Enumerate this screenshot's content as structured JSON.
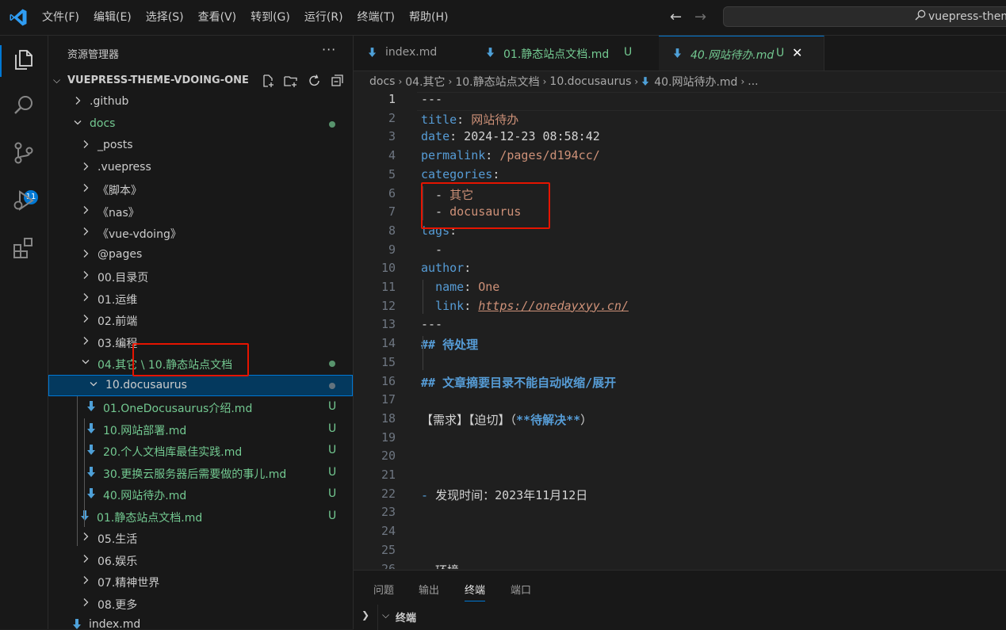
{
  "menu": [
    "文件(F)",
    "编辑(E)",
    "选择(S)",
    "查看(V)",
    "转到(G)",
    "运行(R)",
    "终端(T)",
    "帮助(H)"
  ],
  "search": {
    "text": "vuepress-them"
  },
  "activity": {
    "source_control_badge": "11"
  },
  "explorer": {
    "title": "资源管理器",
    "more": "···",
    "project": "VUEPRESS-THEME-VDOING-ONE",
    "tree": [
      {
        "label": ".github",
        "kind": "folder",
        "open": false,
        "indent": 0
      },
      {
        "label": "docs",
        "kind": "folder",
        "open": true,
        "indent": 0,
        "status": "dot",
        "color": "green"
      },
      {
        "label": "_posts",
        "kind": "folder",
        "open": false,
        "indent": 1
      },
      {
        "label": ".vuepress",
        "kind": "folder",
        "open": false,
        "indent": 1
      },
      {
        "label": "《脚本》",
        "kind": "folder",
        "open": false,
        "indent": 1
      },
      {
        "label": "《nas》",
        "kind": "folder",
        "open": false,
        "indent": 1
      },
      {
        "label": "《vue-vdoing》",
        "kind": "folder",
        "open": false,
        "indent": 1
      },
      {
        "label": "@pages",
        "kind": "folder",
        "open": false,
        "indent": 1
      },
      {
        "label": "00.目录页",
        "kind": "folder",
        "open": false,
        "indent": 1
      },
      {
        "label": "01.运维",
        "kind": "folder",
        "open": false,
        "indent": 1
      },
      {
        "label": "02.前端",
        "kind": "folder",
        "open": false,
        "indent": 1
      },
      {
        "label": "03.编程",
        "kind": "folder",
        "open": false,
        "indent": 1
      },
      {
        "label": "04.其它 \\ 10.静态站点文档",
        "kind": "folder",
        "open": true,
        "indent": 1,
        "status": "dot",
        "color": "green"
      },
      {
        "label": "10.docusaurus",
        "kind": "folder",
        "open": true,
        "indent": 2,
        "status": "dot-grey",
        "selected": true
      },
      {
        "label": "01.OneDocusaurus介绍.md",
        "kind": "md",
        "indent": 3,
        "status": "U",
        "color": "green"
      },
      {
        "label": "10.网站部署.md",
        "kind": "md",
        "indent": 3,
        "status": "U",
        "color": "green"
      },
      {
        "label": "20.个人文档库最佳实践.md",
        "kind": "md",
        "indent": 3,
        "status": "U",
        "color": "green"
      },
      {
        "label": "30.更换云服务器后需要做的事儿.md",
        "kind": "md",
        "indent": 3,
        "status": "U",
        "color": "green"
      },
      {
        "label": "40.网站待办.md",
        "kind": "md",
        "indent": 3,
        "status": "U",
        "color": "green"
      },
      {
        "label": "01.静态站点文档.md",
        "kind": "md",
        "indent": 2,
        "status": "U",
        "color": "green"
      },
      {
        "label": "05.生活",
        "kind": "folder",
        "open": false,
        "indent": 1
      },
      {
        "label": "06.娱乐",
        "kind": "folder",
        "open": false,
        "indent": 1
      },
      {
        "label": "07.精神世界",
        "kind": "folder",
        "open": false,
        "indent": 1
      },
      {
        "label": "08.更多",
        "kind": "folder",
        "open": false,
        "indent": 1
      },
      {
        "label": "index.md",
        "kind": "md",
        "indent": 1
      }
    ]
  },
  "tabs": [
    {
      "label": "index.md",
      "status": "",
      "active": false,
      "style": "normal"
    },
    {
      "label": "01.静态站点文档.md",
      "status": "U",
      "active": false,
      "style": "green"
    },
    {
      "label": "40.网站待办.md",
      "status": "U",
      "active": true,
      "style": "italic"
    }
  ],
  "close_glyph": "✕",
  "breadcrumb": [
    "docs",
    "04.其它",
    "10.静态站点文档",
    "10.docusaurus",
    "40.网站待办.md",
    "..."
  ],
  "editor": {
    "current_line": 1,
    "lines": [
      {
        "n": "1",
        "segs": [
          {
            "t": "---",
            "c": "w"
          }
        ]
      },
      {
        "n": "2",
        "segs": [
          {
            "t": "title",
            "c": "k"
          },
          {
            "t": ": ",
            "c": "w"
          },
          {
            "t": "网站待办",
            "c": "s"
          }
        ]
      },
      {
        "n": "3",
        "segs": [
          {
            "t": "date",
            "c": "k"
          },
          {
            "t": ": 2024-12-23 08:58:42",
            "c": "w"
          }
        ]
      },
      {
        "n": "4",
        "segs": [
          {
            "t": "permalink",
            "c": "k"
          },
          {
            "t": ": ",
            "c": "w"
          },
          {
            "t": "/pages/d194cc/",
            "c": "s"
          }
        ]
      },
      {
        "n": "5",
        "segs": [
          {
            "t": "categories",
            "c": "k"
          },
          {
            "t": ":",
            "c": "w"
          }
        ]
      },
      {
        "n": "6",
        "segs": [
          {
            "t": "  - ",
            "c": "w"
          },
          {
            "t": "其它",
            "c": "s"
          }
        ]
      },
      {
        "n": "7",
        "segs": [
          {
            "t": "  - ",
            "c": "w"
          },
          {
            "t": "docusaurus",
            "c": "s"
          }
        ]
      },
      {
        "n": "8",
        "segs": [
          {
            "t": "tags",
            "c": "k"
          },
          {
            "t": ":",
            "c": "w"
          }
        ]
      },
      {
        "n": "9",
        "segs": [
          {
            "t": "  -",
            "c": "w"
          }
        ]
      },
      {
        "n": "10",
        "segs": [
          {
            "t": "author",
            "c": "k"
          },
          {
            "t": ":",
            "c": "w"
          }
        ]
      },
      {
        "n": "11",
        "segs": [
          {
            "t": "  ",
            "c": "w"
          },
          {
            "t": "name",
            "c": "k"
          },
          {
            "t": ": ",
            "c": "w"
          },
          {
            "t": "One",
            "c": "s"
          }
        ]
      },
      {
        "n": "12",
        "segs": [
          {
            "t": "  ",
            "c": "w"
          },
          {
            "t": "link",
            "c": "k"
          },
          {
            "t": ": ",
            "c": "w"
          },
          {
            "t": "https://onedayxyy.cn/",
            "c": "link"
          }
        ]
      },
      {
        "n": "13",
        "segs": [
          {
            "t": "---",
            "c": "w"
          }
        ]
      },
      {
        "n": "14",
        "segs": [
          {
            "t": "## 待处理",
            "c": "h"
          }
        ]
      },
      {
        "n": "15",
        "segs": []
      },
      {
        "n": "16",
        "segs": [
          {
            "t": "## 文章摘要目录不能自动收缩/展开",
            "c": "h"
          }
        ]
      },
      {
        "n": "17",
        "segs": []
      },
      {
        "n": "18",
        "segs": [
          {
            "t": "【需求】【迫切】（",
            "c": "w"
          },
          {
            "t": "**待解决**",
            "c": "h"
          },
          {
            "t": "）",
            "c": "w"
          }
        ]
      },
      {
        "n": "19",
        "segs": []
      },
      {
        "n": "20",
        "segs": []
      },
      {
        "n": "21",
        "segs": []
      },
      {
        "n": "22",
        "segs": [
          {
            "t": "- ",
            "c": "k"
          },
          {
            "t": "发现时间：2023年11月12日",
            "c": "w"
          }
        ]
      },
      {
        "n": "23",
        "segs": []
      },
      {
        "n": "24",
        "segs": []
      },
      {
        "n": "25",
        "segs": []
      },
      {
        "n": "26",
        "segs": [
          {
            "t": "  环境",
            "c": "w"
          }
        ]
      }
    ]
  },
  "panel": {
    "tabs": [
      "问题",
      "输出",
      "终端",
      "端口"
    ],
    "active": "终端",
    "section": "终端"
  }
}
